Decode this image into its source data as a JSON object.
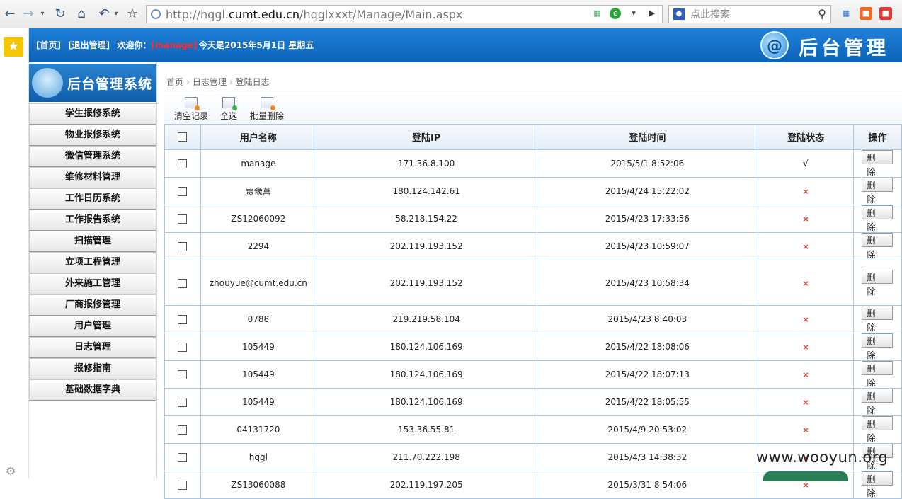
{
  "browser": {
    "url_prefix": "http://hqgl.",
    "url_domain": "cumt.edu.cn",
    "url_path": "/hqglxxxt/Manage/Main.aspx",
    "search_placeholder": "点此搜索"
  },
  "header": {
    "home_link": "[首页]",
    "logout_link": "[退出管理]",
    "welcome": "欢迎你：",
    "username": "[manage]",
    "date_text": "今天是2015年5月1日 星期五",
    "brand_title": "后台管理"
  },
  "sidebar": {
    "title": "后台管理系统",
    "items": [
      {
        "label": "学生报修系统"
      },
      {
        "label": "物业报修系统"
      },
      {
        "label": "微信管理系统"
      },
      {
        "label": "维修材料管理"
      },
      {
        "label": "工作日历系统"
      },
      {
        "label": "工作报告系统"
      },
      {
        "label": "扫描管理"
      },
      {
        "label": "立项工程管理"
      },
      {
        "label": "外来施工管理"
      },
      {
        "label": "厂商报修管理"
      },
      {
        "label": "用户管理"
      },
      {
        "label": "日志管理"
      },
      {
        "label": "报修指南"
      },
      {
        "label": "基础数据字典"
      }
    ]
  },
  "breadcrumb": [
    "首页",
    "日志管理",
    "登陆日志"
  ],
  "toolbar": {
    "clear_label": "清空记录",
    "select_all_label": "全选",
    "batch_delete_label": "批量删除"
  },
  "table": {
    "headers": [
      "用户名称",
      "登陆IP",
      "登陆时间",
      "登陆状态",
      "操作"
    ],
    "delete_label": "删除",
    "rows": [
      {
        "user": "manage",
        "ip": "171.36.8.100",
        "time": "2015/5/1 8:52:06",
        "status": "√"
      },
      {
        "user": "贾豫菖",
        "ip": "180.124.142.61",
        "time": "2015/4/24 15:22:02",
        "status": "×"
      },
      {
        "user": "ZS12060092",
        "ip": "58.218.154.22",
        "time": "2015/4/23 17:33:56",
        "status": "×"
      },
      {
        "user": "2294",
        "ip": "202.119.193.152",
        "time": "2015/4/23 10:59:07",
        "status": "×"
      },
      {
        "user": "zhouyue@cumt.edu.cn",
        "ip": "202.119.193.152",
        "time": "2015/4/23 10:58:34",
        "status": "×"
      },
      {
        "user": "0788",
        "ip": "219.219.58.104",
        "time": "2015/4/23 8:40:03",
        "status": "×"
      },
      {
        "user": "105449",
        "ip": "180.124.106.169",
        "time": "2015/4/22 18:08:06",
        "status": "×"
      },
      {
        "user": "105449",
        "ip": "180.124.106.169",
        "time": "2015/4/22 18:07:13",
        "status": "×"
      },
      {
        "user": "105449",
        "ip": "180.124.106.169",
        "time": "2015/4/22 18:05:55",
        "status": "×"
      },
      {
        "user": "04131720",
        "ip": "153.36.55.81",
        "time": "2015/4/9 20:53:02",
        "status": "×"
      },
      {
        "user": "hqgl",
        "ip": "211.70.222.198",
        "time": "2015/4/3 14:38:32",
        "status": "×"
      },
      {
        "user": "ZS13060088",
        "ip": "202.119.197.205",
        "time": "2015/3/31 8:54:06",
        "status": "×"
      }
    ]
  },
  "watermark": "www.wooyun.org",
  "colors": {
    "header_blue": "#0c63b8",
    "status_fail": "#e23a2a",
    "grid_border": "#a8c7e6"
  }
}
